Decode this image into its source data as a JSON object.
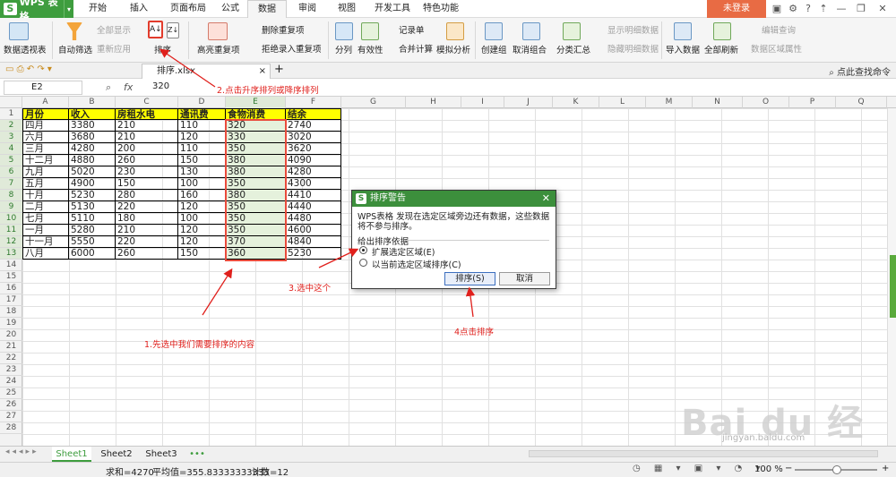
{
  "app": {
    "logo": "WPS 表格",
    "login": "未登录"
  },
  "menu": [
    "开始",
    "插入",
    "页面布局",
    "公式",
    "数据",
    "审阅",
    "视图",
    "开发工具",
    "特色功能"
  ],
  "active_menu": "数据",
  "ribbon": {
    "pivot": "数据透视表",
    "autofilter": "自动筛选",
    "show_all": "全部显示",
    "reapply": "重新应用",
    "sort": "排序",
    "highlight_dup": "高亮重复项",
    "delete_dup": "删除重复项",
    "reject_dup": "拒绝录入重复项",
    "split": "分列",
    "validation": "有效性",
    "record": "记录单",
    "consolidate": "合并计算",
    "simulate": "模拟分析",
    "group": "创建组",
    "ungroup": "取消组合",
    "subtotal": "分类汇总",
    "show_detail": "显示明细数据",
    "hide_detail": "隐藏明细数据",
    "import": "导入数据",
    "refresh_all": "全部刷新",
    "edit_query": "编辑查询",
    "range_props": "数据区域属性"
  },
  "file_tab": "排序.xlsx",
  "file_search": "点此查找命令",
  "namebox": "E2",
  "fx": "fx",
  "formula": "320",
  "columns": [
    "A",
    "B",
    "C",
    "D",
    "E",
    "F",
    "G",
    "H",
    "I",
    "J",
    "K",
    "L",
    "M",
    "N",
    "O",
    "P",
    "Q"
  ],
  "rows": [
    "1",
    "2",
    "3",
    "4",
    "5",
    "6",
    "7",
    "8",
    "9",
    "10",
    "11",
    "12",
    "13",
    "14",
    "15",
    "16",
    "17",
    "18",
    "19",
    "20",
    "21",
    "22",
    "23",
    "24",
    "25",
    "26",
    "27",
    "28"
  ],
  "table": {
    "headers": [
      "月份",
      "收入",
      "房租水电",
      "通讯费",
      "食物消费",
      "结余"
    ],
    "rows": [
      [
        "四月",
        "3380",
        "210",
        "110",
        "320",
        "2740"
      ],
      [
        "六月",
        "3680",
        "210",
        "120",
        "330",
        "3020"
      ],
      [
        "三月",
        "4280",
        "200",
        "110",
        "350",
        "3620"
      ],
      [
        "十二月",
        "4880",
        "260",
        "150",
        "380",
        "4090"
      ],
      [
        "九月",
        "5020",
        "230",
        "130",
        "380",
        "4280"
      ],
      [
        "五月",
        "4900",
        "150",
        "100",
        "350",
        "4300"
      ],
      [
        "十月",
        "5230",
        "280",
        "160",
        "380",
        "4410"
      ],
      [
        "二月",
        "5130",
        "220",
        "120",
        "350",
        "4440"
      ],
      [
        "七月",
        "5110",
        "180",
        "100",
        "350",
        "4480"
      ],
      [
        "一月",
        "5280",
        "210",
        "120",
        "350",
        "4600"
      ],
      [
        "十一月",
        "5550",
        "220",
        "120",
        "370",
        "4840"
      ],
      [
        "八月",
        "6000",
        "260",
        "150",
        "360",
        "5230"
      ]
    ]
  },
  "dialog": {
    "title": "排序警告",
    "message": "WPS表格 发现在选定区域旁边还有数据，这些数据将不参与排序。",
    "group": "给出排序依据",
    "option1": "扩展选定区域(E)",
    "option2": "以当前选定区域排序(C)",
    "ok": "排序(S)",
    "cancel": "取消"
  },
  "annotations": {
    "a1": "1.先选中我们需要排序的内容",
    "a2": "2.点击升序排列或降序排列",
    "a3": "3.选中这个",
    "a4": "4点击排序"
  },
  "sheets": [
    "Sheet1",
    "Sheet2",
    "Sheet3"
  ],
  "status": {
    "sum": "求和=4270",
    "avg": "平均值=355.83333333333",
    "count": "计数=12",
    "zoom": "100 %"
  },
  "watermark": {
    "brand": "Bai du 经验",
    "url": "jingyan.baidu.com"
  }
}
